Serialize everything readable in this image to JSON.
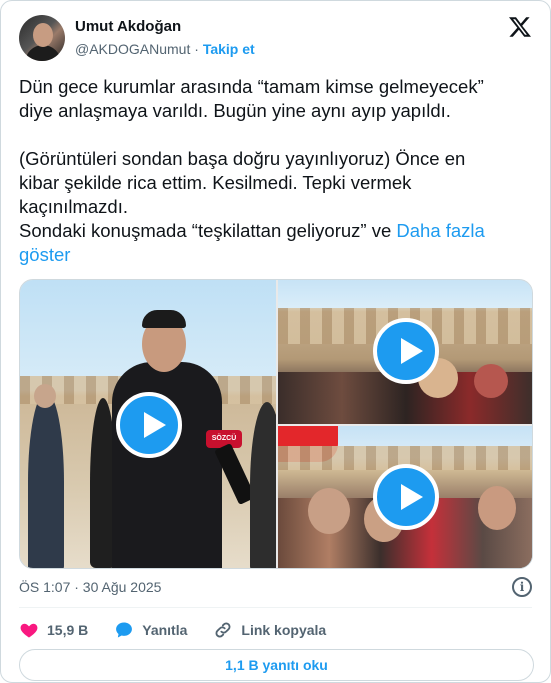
{
  "author": {
    "name": "Umut Akdoğan",
    "handle": "@AKDOGANumut",
    "separator": "·",
    "follow_label": "Takip et"
  },
  "tweet": {
    "line1": "Dün gece kurumlar arasında “tamam kimse gelmeyecek”",
    "line2": "diye anlaşmaya varıldı. Bugün yine aynı ayıp yapıldı.",
    "line3": "(Görüntüleri sondan başa doğru yayınlıyoruz) Önce en",
    "line4": "kibar şekilde rica ettim. Kesilmedi. Tepki vermek",
    "line5": "kaçınılmazdı.",
    "line6": "Sondaki konuşmada “teşkilattan geliyoruz” ve ",
    "more_part1": "Daha fazla",
    "more_part2": "göster"
  },
  "media": {
    "videos": [
      {
        "label": "video-1"
      },
      {
        "label": "video-2"
      },
      {
        "label": "video-3"
      }
    ],
    "microphone_text": "SÖZCÜ"
  },
  "meta": {
    "timestamp": "ÖS 1:07 · 30 Ağu 2025",
    "info_icon": "info-icon"
  },
  "actions": {
    "likes_count": "15,9 B",
    "reply_label": "Yanıtla",
    "copy_link_label": "Link kopyala"
  },
  "replies_button": "1,1 B yanıtı oku",
  "colors": {
    "accent": "#1d9bf0",
    "like_heart": "#f91880",
    "text": "#0f1419",
    "muted": "#536471"
  }
}
